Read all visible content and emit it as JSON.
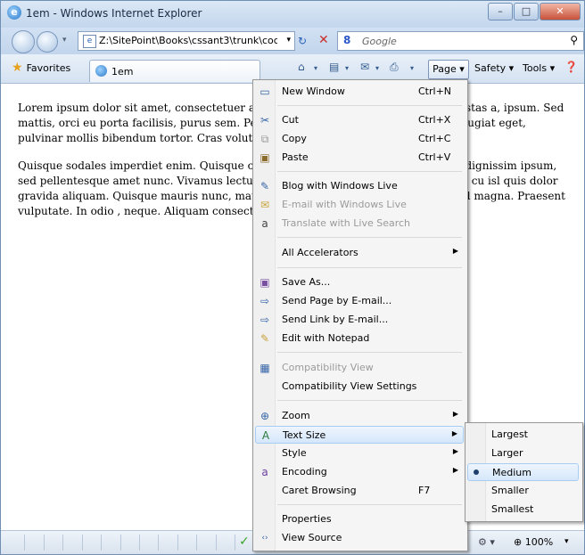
{
  "window": {
    "title": "1em - Windows Internet Explorer",
    "minimize": "–",
    "maximize": "□",
    "close": "✕"
  },
  "address": {
    "url": "Z:\\SitePoint\\Books\\cssant3\\trunk\\coc",
    "search_logo": "8",
    "search_placeholder": "Google"
  },
  "command_bar": {
    "favorites_label": "Favorites",
    "tab_label": "1em",
    "page_label": "Page ▾",
    "safety_label": "Safety ▾",
    "tools_label": "Tools ▾"
  },
  "content": {
    "para1": "Lorem ipsum dolor sit amet, consectetuer adipiscing elit. Mauris tincidunt eu, egestas a, ipsum. Sed mattis, orci eu porta facilisis, purus sem. Pellentesque tortor sapien, sodales eu, feugiat eget, pulvinar mollis bibendum tortor. Cras volutpat ipsum ac sapien.",
    "para2": "Quisque sodales imperdiet enim. Quisque cur ac fringilla consequat, ipsum turpis dignissim ipsum, sed pellentesque amet nunc. Vivamus lectus nisl, facilisis at, pretium at, bibendum cu isl quis dolor gravida aliquam. Quisque mauris nunc, mattis vitae, di ean pellentesque metus sed magna. Praesent vulputate. In odio , neque. Aliquam consectetuer mattis tellus."
  },
  "menu": {
    "items": [
      {
        "label": "New Window",
        "shortcut": "Ctrl+N",
        "icon": "new-window-icon"
      },
      {
        "label": "Cut",
        "shortcut": "Ctrl+X",
        "icon": "cut-icon"
      },
      {
        "label": "Copy",
        "shortcut": "Ctrl+C",
        "icon": "copy-icon"
      },
      {
        "label": "Paste",
        "shortcut": "Ctrl+V",
        "icon": "paste-icon"
      },
      {
        "label": "Blog with Windows Live",
        "icon": "blog-icon"
      },
      {
        "label": "E-mail with Windows Live",
        "icon": "email-live-icon"
      },
      {
        "label": "Translate with Live Search",
        "icon": "translate-icon"
      },
      {
        "label": "All Accelerators",
        "arrow": "▶"
      },
      {
        "label": "Save As...",
        "icon": "save-icon"
      },
      {
        "label": "Send Page by E-mail...",
        "icon": "send-page-icon"
      },
      {
        "label": "Send Link by E-mail...",
        "icon": "send-link-icon"
      },
      {
        "label": "Edit with Notepad",
        "icon": "edit-icon"
      },
      {
        "label": "Compatibility View",
        "icon": "compat-icon"
      },
      {
        "label": "Compatibility View Settings"
      },
      {
        "label": "Zoom",
        "arrow": "▶",
        "icon": "zoom-icon"
      },
      {
        "label": "Text Size",
        "arrow": "▶",
        "icon": "text-size-icon"
      },
      {
        "label": "Style",
        "arrow": "▶"
      },
      {
        "label": "Encoding",
        "arrow": "▶",
        "icon": "encoding-icon"
      },
      {
        "label": "Caret Browsing",
        "shortcut": "F7"
      },
      {
        "label": "Properties"
      },
      {
        "label": "View Source",
        "icon": "view-source-icon"
      }
    ]
  },
  "submenu": {
    "items": [
      "Largest",
      "Larger",
      "Medium",
      "Smaller",
      "Smallest"
    ],
    "selected": "Medium"
  },
  "status": {
    "zoom": "100%"
  }
}
